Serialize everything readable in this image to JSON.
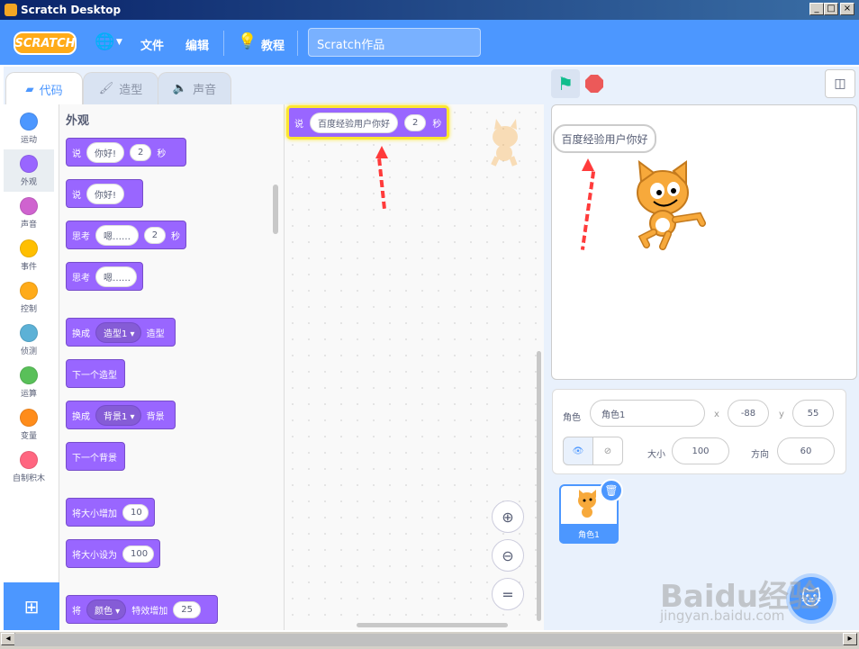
{
  "window": {
    "title": "Scratch Desktop"
  },
  "menubar": {
    "logo": "SCRATCH",
    "file": "文件",
    "edit": "编辑",
    "tutorials": "教程",
    "project_title": "Scratch作品"
  },
  "tabs": {
    "code": "代码",
    "costumes": "造型",
    "sounds": "声音"
  },
  "categories": [
    {
      "label": "运动",
      "color": "#4c97ff"
    },
    {
      "label": "外观",
      "color": "#9966ff"
    },
    {
      "label": "声音",
      "color": "#cf63cf"
    },
    {
      "label": "事件",
      "color": "#ffbf00"
    },
    {
      "label": "控制",
      "color": "#ffab19"
    },
    {
      "label": "侦测",
      "color": "#5cb1d6"
    },
    {
      "label": "运算",
      "color": "#59c059"
    },
    {
      "label": "变量",
      "color": "#ff8c1a"
    },
    {
      "label": "自制积木",
      "color": "#ff6680"
    }
  ],
  "palette": {
    "title": "外观",
    "say_for": {
      "say": "说",
      "text": "你好!",
      "secs": "2",
      "unit": "秒"
    },
    "say": {
      "say": "说",
      "text": "你好!"
    },
    "think_for": {
      "think": "思考",
      "text": "嗯……",
      "secs": "2",
      "unit": "秒"
    },
    "think": {
      "think": "思考",
      "text": "嗯……"
    },
    "switch_costume": {
      "pre": "换成",
      "value": "造型1",
      "post": "造型"
    },
    "next_costume": "下一个造型",
    "switch_backdrop": {
      "pre": "换成",
      "value": "背景1",
      "post": "背景"
    },
    "next_backdrop": "下一个背景",
    "change_size": {
      "label": "将大小增加",
      "value": "10"
    },
    "set_size": {
      "label": "将大小设为",
      "value": "100"
    },
    "change_effect": {
      "pre": "将",
      "effect": "颜色",
      "mid": "特效增加",
      "value": "25"
    }
  },
  "workspace": {
    "block": {
      "say": "说",
      "text": "百度经验用户你好",
      "secs": "2",
      "unit": "秒"
    }
  },
  "stage": {
    "bubble": "百度经验用户你好"
  },
  "sprite_info": {
    "sprite_label": "角色",
    "sprite_name": "角色1",
    "x_label": "x",
    "x": "-88",
    "y_label": "y",
    "y": "55",
    "size_label": "大小",
    "size": "100",
    "direction_label": "方向",
    "direction": "60"
  },
  "sprite_list": [
    {
      "name": "角色1"
    }
  ],
  "watermark": {
    "brand": "Baidu经验",
    "url": "jingyan.baidu.com"
  }
}
